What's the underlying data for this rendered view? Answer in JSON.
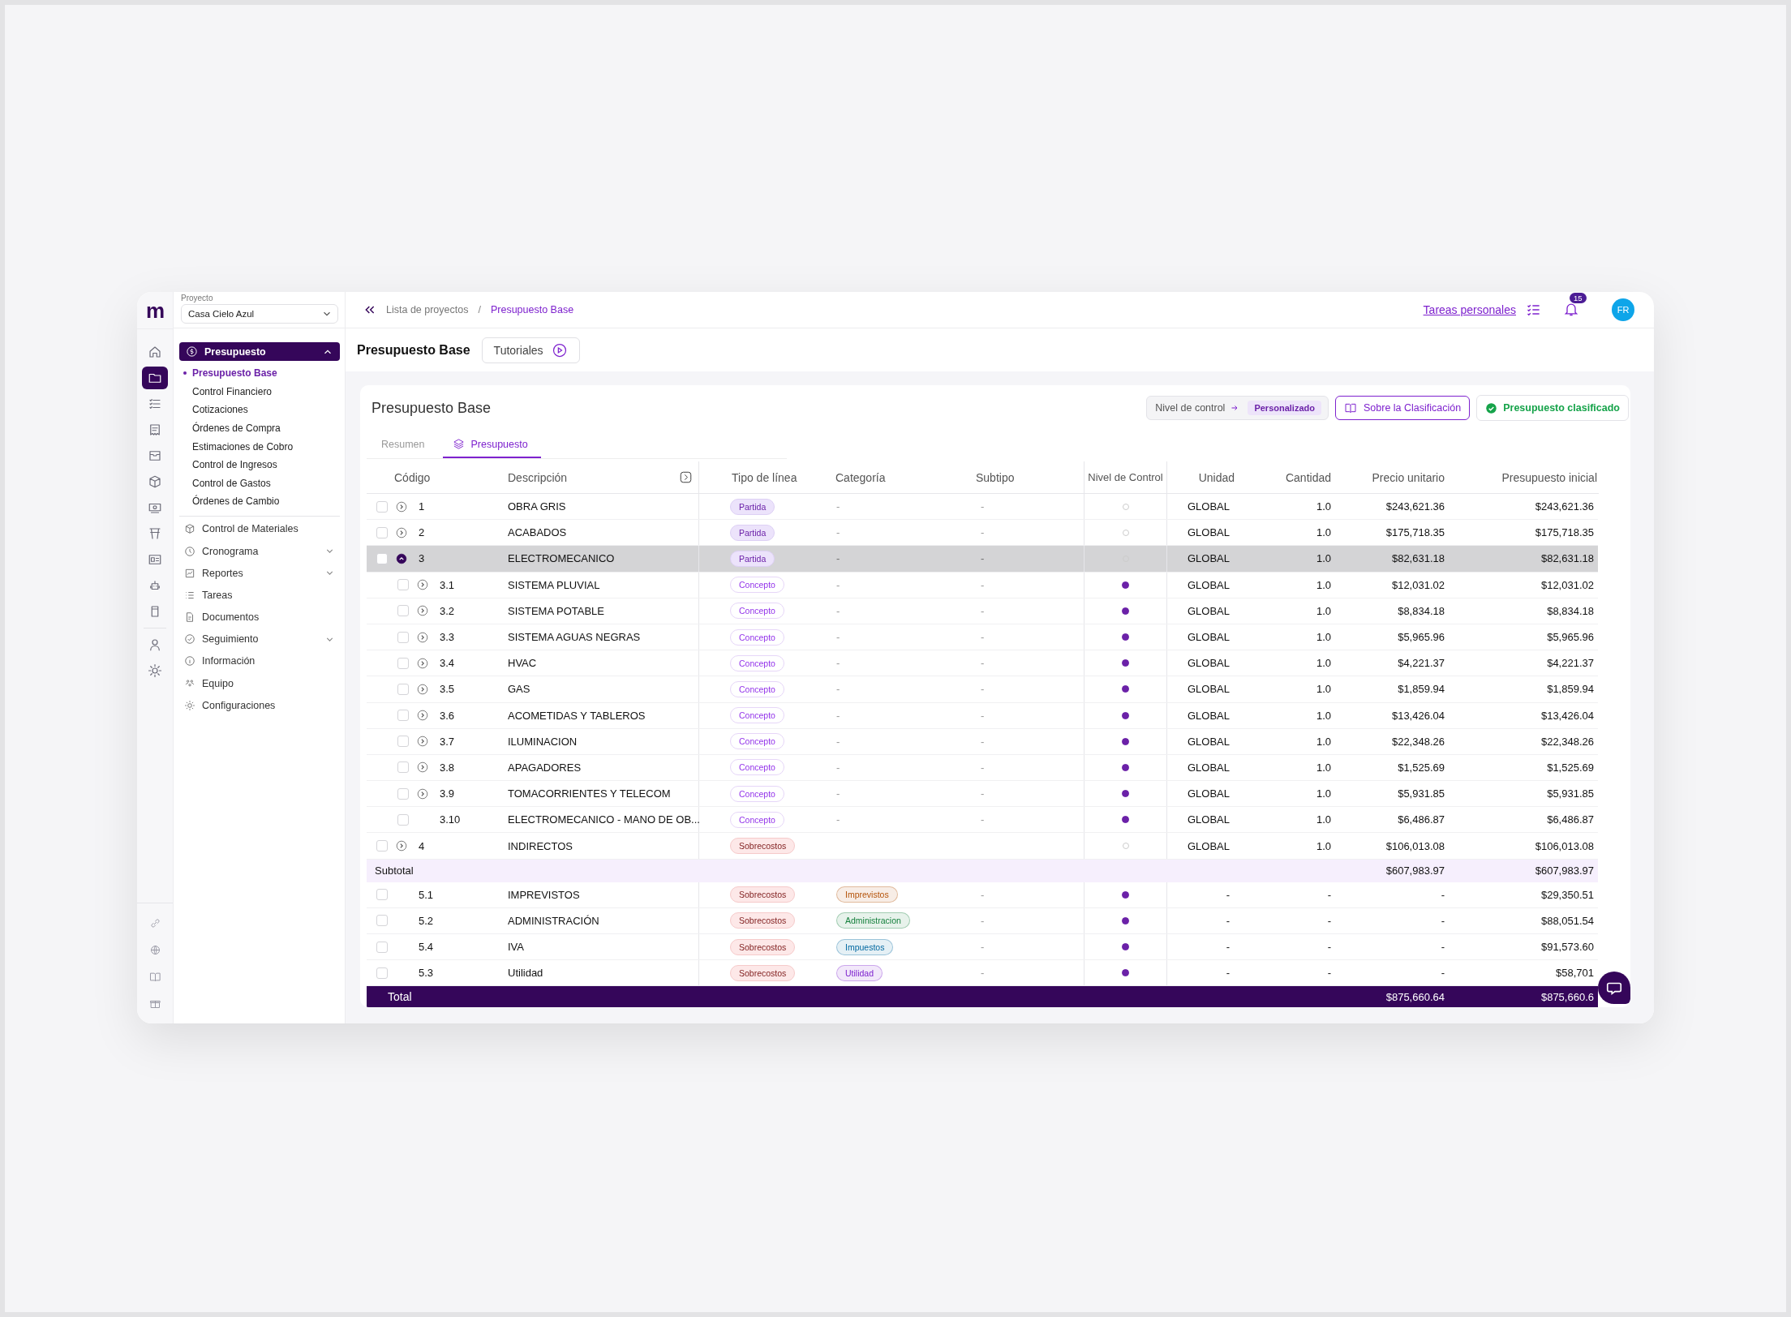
{
  "logo": "m",
  "rail": [
    {
      "selected": false
    },
    {
      "selected": true
    },
    {
      "selected": false
    },
    {
      "selected": false
    },
    {
      "selected": false
    },
    {
      "selected": false
    },
    {
      "selected": false
    },
    {
      "selected": false
    },
    {
      "selected": false
    },
    {
      "selected": false
    },
    {
      "selected": false
    },
    {
      "selected": false
    },
    {
      "selected": false
    }
  ],
  "rail_bottom": [
    {
      "selected": false
    },
    {
      "selected": false
    },
    {
      "selected": false
    },
    {
      "selected": false
    }
  ],
  "project": {
    "label": "Proyecto",
    "value": "Casa Cielo Azul"
  },
  "sidebar": {
    "section": {
      "label": "Presupuesto",
      "expanded": true,
      "items": [
        {
          "label": "Presupuesto Base",
          "selected": true
        },
        {
          "label": "Control Financiero",
          "selected": false
        },
        {
          "label": "Cotizaciones",
          "selected": false
        },
        {
          "label": "Órdenes de Compra",
          "selected": false
        },
        {
          "label": "Estimaciones de Cobro",
          "selected": false
        },
        {
          "label": "Control de Ingresos",
          "selected": false
        },
        {
          "label": "Control de Gastos",
          "selected": false
        },
        {
          "label": "Órdenes de Cambio",
          "selected": false
        }
      ]
    },
    "items": [
      {
        "label": "Control de Materiales",
        "expandable": false
      },
      {
        "label": "Cronograma",
        "expandable": true
      },
      {
        "label": "Reportes",
        "expandable": true
      },
      {
        "label": "Tareas",
        "expandable": false
      },
      {
        "label": "Documentos",
        "expandable": false
      },
      {
        "label": "Seguimiento",
        "expandable": true
      },
      {
        "label": "Información",
        "expandable": false
      },
      {
        "label": "Equipo",
        "expandable": false
      },
      {
        "label": "Configuraciones",
        "expandable": false
      }
    ]
  },
  "breadcrumb": [
    {
      "label": "Lista de proyectos",
      "selected": false
    },
    {
      "label": "Presupuesto Base",
      "selected": true
    }
  ],
  "breadcrumb_separator": "/",
  "personal_tasks": "Tareas personales",
  "notifications": "15",
  "avatar": "FR",
  "page_title": "Presupuesto Base",
  "tutorials": "Tutoriales",
  "card": {
    "title": "Presupuesto Base",
    "control_level": {
      "label": "Nivel de control",
      "value": "Personalizado"
    },
    "about": "Sobre la Clasificación",
    "status": "Presupuesto clasificado"
  },
  "tabs": [
    {
      "label": "Resumen",
      "selected": false
    },
    {
      "label": "Presupuesto",
      "selected": true
    }
  ],
  "table": {
    "columns": [
      "Código",
      "Descripción",
      "Tipo de línea",
      "Categoría",
      "Subtipo",
      "Nivel de Control",
      "Unidad",
      "Cantidad",
      "Precio unitario",
      "Presupuesto inicial"
    ],
    "rows": [
      {
        "kind": "row",
        "code": "1",
        "description": "OBRA GRIS",
        "expandable": true,
        "expanded": false,
        "selected": false,
        "line_type": {
          "label": "Partida",
          "kind": "partida"
        },
        "category": "-",
        "subtype": "-",
        "controlled": false,
        "unit": "GLOBAL",
        "quantity": "1.0",
        "unit_price": "$243,621.36",
        "initial_budget": "$243,621.36"
      },
      {
        "kind": "row",
        "code": "2",
        "description": "ACABADOS",
        "expandable": true,
        "expanded": false,
        "selected": false,
        "line_type": {
          "label": "Partida",
          "kind": "partida"
        },
        "category": "-",
        "subtype": "-",
        "controlled": false,
        "unit": "GLOBAL",
        "quantity": "1.0",
        "unit_price": "$175,718.35",
        "initial_budget": "$175,718.35"
      },
      {
        "kind": "row",
        "code": "3",
        "description": "ELECTROMECANICO",
        "expandable": true,
        "expanded": true,
        "selected": true,
        "line_type": {
          "label": "Partida",
          "kind": "partida"
        },
        "category": "-",
        "subtype": "-",
        "controlled": false,
        "unit": "GLOBAL",
        "quantity": "1.0",
        "unit_price": "$82,631.18",
        "initial_budget": "$82,631.18",
        "children": [
          {
            "kind": "row",
            "code": "3.1",
            "description": "SISTEMA PLUVIAL",
            "expandable": true,
            "expanded": false,
            "selected": false,
            "line_type": {
              "label": "Concepto",
              "kind": "concepto"
            },
            "category": "-",
            "subtype": "-",
            "controlled": true,
            "unit": "GLOBAL",
            "quantity": "1.0",
            "unit_price": "$12,031.02",
            "initial_budget": "$12,031.02"
          },
          {
            "kind": "row",
            "code": "3.2",
            "description": "SISTEMA POTABLE",
            "expandable": true,
            "expanded": false,
            "selected": false,
            "line_type": {
              "label": "Concepto",
              "kind": "concepto"
            },
            "category": "-",
            "subtype": "-",
            "controlled": true,
            "unit": "GLOBAL",
            "quantity": "1.0",
            "unit_price": "$8,834.18",
            "initial_budget": "$8,834.18"
          },
          {
            "kind": "row",
            "code": "3.3",
            "description": "SISTEMA AGUAS NEGRAS",
            "expandable": true,
            "expanded": false,
            "selected": false,
            "line_type": {
              "label": "Concepto",
              "kind": "concepto"
            },
            "category": "-",
            "subtype": "-",
            "controlled": true,
            "unit": "GLOBAL",
            "quantity": "1.0",
            "unit_price": "$5,965.96",
            "initial_budget": "$5,965.96"
          },
          {
            "kind": "row",
            "code": "3.4",
            "description": "HVAC",
            "expandable": true,
            "expanded": false,
            "selected": false,
            "line_type": {
              "label": "Concepto",
              "kind": "concepto"
            },
            "category": "-",
            "subtype": "-",
            "controlled": true,
            "unit": "GLOBAL",
            "quantity": "1.0",
            "unit_price": "$4,221.37",
            "initial_budget": "$4,221.37"
          },
          {
            "kind": "row",
            "code": "3.5",
            "description": "GAS",
            "expandable": true,
            "expanded": false,
            "selected": false,
            "line_type": {
              "label": "Concepto",
              "kind": "concepto"
            },
            "category": "-",
            "subtype": "-",
            "controlled": true,
            "unit": "GLOBAL",
            "quantity": "1.0",
            "unit_price": "$1,859.94",
            "initial_budget": "$1,859.94"
          },
          {
            "kind": "row",
            "code": "3.6",
            "description": "ACOMETIDAS Y TABLEROS",
            "expandable": true,
            "expanded": false,
            "selected": false,
            "line_type": {
              "label": "Concepto",
              "kind": "concepto"
            },
            "category": "-",
            "subtype": "-",
            "controlled": true,
            "unit": "GLOBAL",
            "quantity": "1.0",
            "unit_price": "$13,426.04",
            "initial_budget": "$13,426.04"
          },
          {
            "kind": "row",
            "code": "3.7",
            "description": "ILUMINACION",
            "expandable": true,
            "expanded": false,
            "selected": false,
            "line_type": {
              "label": "Concepto",
              "kind": "concepto"
            },
            "category": "-",
            "subtype": "-",
            "controlled": true,
            "unit": "GLOBAL",
            "quantity": "1.0",
            "unit_price": "$22,348.26",
            "initial_budget": "$22,348.26"
          },
          {
            "kind": "row",
            "code": "3.8",
            "description": "APAGADORES",
            "expandable": true,
            "expanded": false,
            "selected": false,
            "line_type": {
              "label": "Concepto",
              "kind": "concepto"
            },
            "category": "-",
            "subtype": "-",
            "controlled": true,
            "unit": "GLOBAL",
            "quantity": "1.0",
            "unit_price": "$1,525.69",
            "initial_budget": "$1,525.69"
          },
          {
            "kind": "row",
            "code": "3.9",
            "description": "TOMACORRIENTES Y TELECOM",
            "expandable": true,
            "expanded": false,
            "selected": false,
            "line_type": {
              "label": "Concepto",
              "kind": "concepto"
            },
            "category": "-",
            "subtype": "-",
            "controlled": true,
            "unit": "GLOBAL",
            "quantity": "1.0",
            "unit_price": "$5,931.85",
            "initial_budget": "$5,931.85"
          },
          {
            "kind": "row",
            "code": "3.10",
            "description": "ELECTROMECANICO - MANO DE OB...",
            "expandable": false,
            "selected": false,
            "line_type": {
              "label": "Concepto",
              "kind": "concepto"
            },
            "category": "-",
            "subtype": "-",
            "controlled": true,
            "unit": "GLOBAL",
            "quantity": "1.0",
            "unit_price": "$6,486.87",
            "initial_budget": "$6,486.87"
          }
        ]
      },
      {
        "kind": "row",
        "code": "4",
        "description": "INDIRECTOS",
        "expandable": true,
        "expanded": false,
        "selected": false,
        "line_type": {
          "label": "Sobrecostos",
          "kind": "sobrecostos"
        },
        "controlled": false,
        "unit": "GLOBAL",
        "quantity": "1.0",
        "unit_price": "$106,013.08",
        "initial_budget": "$106,013.08"
      },
      {
        "kind": "subtotal",
        "label": "Subtotal",
        "unit_price": "$607,983.97",
        "initial_budget": "$607,983.97"
      },
      {
        "kind": "row",
        "code": "5.1",
        "description": "IMPREVISTOS",
        "expandable": false,
        "selected": false,
        "line_type": {
          "label": "Sobrecostos",
          "kind": "sobrecostos"
        },
        "category": {
          "label": "Imprevistos",
          "color": "#b45309"
        },
        "subtype": "-",
        "controlled": true,
        "unit": "-",
        "quantity": "-",
        "unit_price": "-",
        "initial_budget": "$29,350.51"
      },
      {
        "kind": "row",
        "code": "5.2",
        "description": "ADMINISTRACIÓN",
        "expandable": false,
        "selected": false,
        "line_type": {
          "label": "Sobrecostos",
          "kind": "sobrecostos"
        },
        "category": {
          "label": "Administracion",
          "color": "#15803d"
        },
        "subtype": "-",
        "controlled": true,
        "unit": "-",
        "quantity": "-",
        "unit_price": "-",
        "initial_budget": "$88,051.54"
      },
      {
        "kind": "row",
        "code": "5.4",
        "description": "IVA",
        "expandable": false,
        "selected": false,
        "line_type": {
          "label": "Sobrecostos",
          "kind": "sobrecostos"
        },
        "category": {
          "label": "Impuestos",
          "color": "#0369a1"
        },
        "subtype": "-",
        "controlled": true,
        "unit": "-",
        "quantity": "-",
        "unit_price": "-",
        "initial_budget": "$91,573.60"
      },
      {
        "kind": "row",
        "code": "5.3",
        "description": "Utilidad",
        "expandable": false,
        "selected": false,
        "line_type": {
          "label": "Sobrecostos",
          "kind": "sobrecostos"
        },
        "category": {
          "label": "Utilidad",
          "color": "#7e22ce"
        },
        "subtype": "-",
        "controlled": true,
        "unit": "-",
        "quantity": "-",
        "unit_price": "-",
        "initial_budget": "$58,701"
      },
      {
        "kind": "total",
        "label": "Total",
        "unit_price": "$875,660.64",
        "initial_budget": "$875,660.6"
      }
    ]
  }
}
